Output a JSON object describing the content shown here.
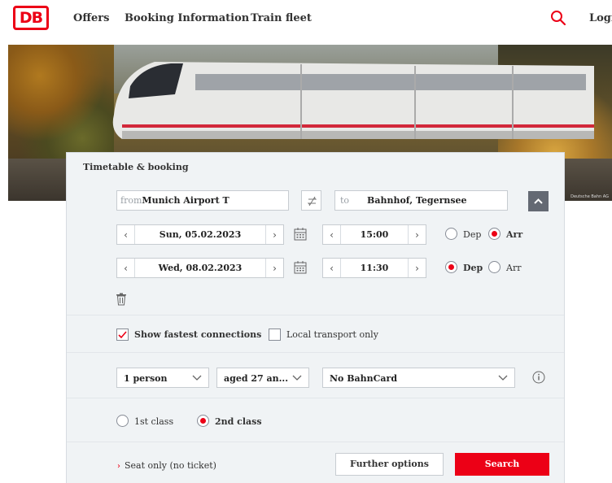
{
  "header": {
    "logo_text": "DB",
    "nav": [
      "Offers",
      "Booking Information",
      "Train fleet"
    ],
    "login_label": "Logi"
  },
  "hero": {
    "credit": "Deutsche Bahn AG"
  },
  "booking": {
    "title": "Timetable & booking",
    "from": {
      "placeholder": "from",
      "value": "Munich Airport T"
    },
    "to": {
      "placeholder": "to",
      "value": "Bahnhof, Tegernsee"
    },
    "outbound": {
      "date": "Sun, 05.02.2023",
      "time": "15:00",
      "dep_label": "Dep",
      "arr_label": "Arr",
      "selected": "Arr"
    },
    "return": {
      "date": "Wed, 08.02.2023",
      "time": "11:30",
      "dep_label": "Dep",
      "arr_label": "Arr",
      "selected": "Dep"
    },
    "options": {
      "fastest_label": "Show fastest connections",
      "fastest_checked": true,
      "local_label": "Local transport only",
      "local_checked": false
    },
    "travellers": {
      "persons": "1 person",
      "age": "aged 27 an...",
      "bahncard": "No BahnCard"
    },
    "class": {
      "first_label": "1st class",
      "second_label": "2nd class",
      "selected": "2nd"
    },
    "seat_only_label": "Seat only (no ticket)",
    "further_options_label": "Further options",
    "search_label": "Search"
  },
  "colors": {
    "brand_red": "#ec0016",
    "panel_bg": "#f0f3f5",
    "collapse_btn": "#646973"
  }
}
